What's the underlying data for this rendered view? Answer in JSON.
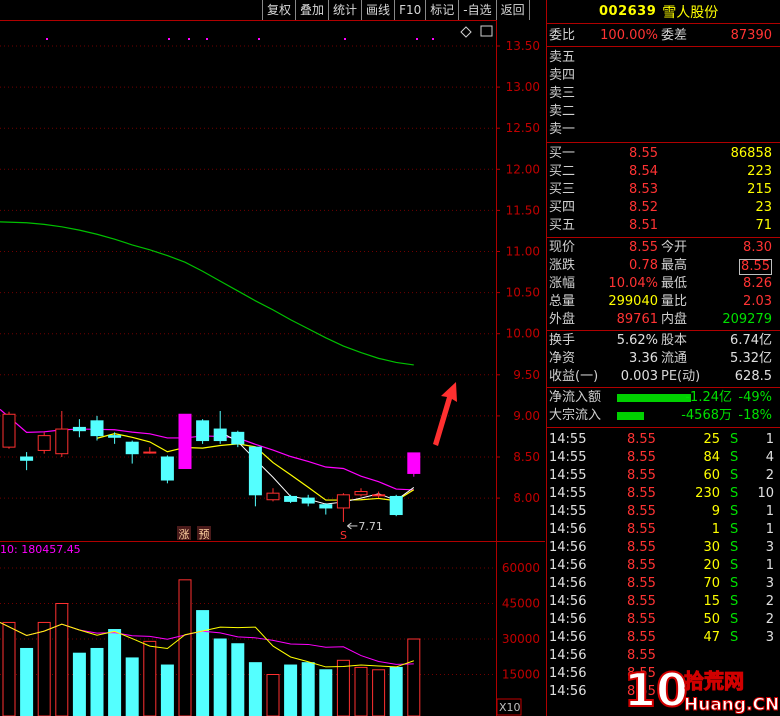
{
  "toolbar": {
    "items": [
      "复权",
      "叠加",
      "统计",
      "画线",
      "F10",
      "标记",
      "-自选",
      "返回"
    ]
  },
  "chart": {
    "price_axis": [
      "13.50",
      "13.00",
      "12.50",
      "12.00",
      "11.50",
      "11.00",
      "10.50",
      "10.00",
      "9.50",
      "9.00",
      "8.50",
      "8.00"
    ],
    "volume_axis": [
      "60000",
      "45000",
      "30000",
      "15000"
    ],
    "volume_unit": "X10",
    "volume_readout": "10: 180457.45",
    "low_marker": "7.71",
    "badge_zhang": "涨",
    "badge_yu": "预",
    "badge_s": "S",
    "colors": {
      "up": "#ff3030",
      "down": "#54ffff",
      "limit_up": "#ff00ff",
      "ma_fast": "#ffffff",
      "ma_mid": "#ffff00",
      "ma_slow": "#ff00ff",
      "ma_long": "#00c000",
      "arrow": "#ff3030"
    }
  },
  "panel": {
    "code": "002639",
    "name": "雪人股份",
    "weibi_label": "委比",
    "weibi_value": "100.00%",
    "weicha_label": "委差",
    "weicha_value": "87390",
    "asks": [
      {
        "label": "卖五",
        "price": "",
        "vol": ""
      },
      {
        "label": "卖四",
        "price": "",
        "vol": ""
      },
      {
        "label": "卖三",
        "price": "",
        "vol": ""
      },
      {
        "label": "卖二",
        "price": "",
        "vol": ""
      },
      {
        "label": "卖一",
        "price": "",
        "vol": ""
      }
    ],
    "bids": [
      {
        "label": "买一",
        "price": "8.55",
        "vol": "86858"
      },
      {
        "label": "买二",
        "price": "8.54",
        "vol": "223"
      },
      {
        "label": "买三",
        "price": "8.53",
        "vol": "215"
      },
      {
        "label": "买四",
        "price": "8.52",
        "vol": "23"
      },
      {
        "label": "买五",
        "price": "8.51",
        "vol": "71"
      }
    ],
    "quote": [
      {
        "l1": "现价",
        "v1": "8.55",
        "c1": "red",
        "l2": "今开",
        "v2": "8.30",
        "c2": "red"
      },
      {
        "l1": "涨跌",
        "v1": "0.78",
        "c1": "red",
        "l2": "最高",
        "v2": "8.55",
        "c2": "red"
      },
      {
        "l1": "涨幅",
        "v1": "10.04%",
        "c1": "red",
        "l2": "最低",
        "v2": "8.26",
        "c2": "red"
      },
      {
        "l1": "总量",
        "v1": "299040",
        "c1": "yellow",
        "l2": "量比",
        "v2": "2.03",
        "c2": "red"
      },
      {
        "l1": "外盘",
        "v1": "89761",
        "c1": "red",
        "l2": "内盘",
        "v2": "209279",
        "c2": "green"
      }
    ],
    "fundamentals": [
      {
        "l1": "换手",
        "v1": "5.62%",
        "l2": "股本",
        "v2": "6.74亿"
      },
      {
        "l1": "净资",
        "v1": "3.36",
        "l2": "流通",
        "v2": "5.32亿"
      },
      {
        "l1": "收益(一)",
        "v1": "0.003",
        "l2": "PE(动)",
        "v2": "628.5"
      }
    ],
    "flows": [
      {
        "label": "净流入额",
        "amount": "-1.24亿",
        "pct": "-49%",
        "bar": 0.49
      },
      {
        "label": "大宗流入",
        "amount": "-4568万",
        "pct": "-18%",
        "bar": 0.18
      }
    ],
    "ticks": [
      {
        "time": "14:55",
        "price": "8.55",
        "vol": "25",
        "bs": "S",
        "cnt": "1"
      },
      {
        "time": "14:55",
        "price": "8.55",
        "vol": "84",
        "bs": "S",
        "cnt": "4"
      },
      {
        "time": "14:55",
        "price": "8.55",
        "vol": "60",
        "bs": "S",
        "cnt": "2"
      },
      {
        "time": "14:55",
        "price": "8.55",
        "vol": "230",
        "bs": "S",
        "cnt": "10"
      },
      {
        "time": "14:55",
        "price": "8.55",
        "vol": "9",
        "bs": "S",
        "cnt": "1"
      },
      {
        "time": "14:56",
        "price": "8.55",
        "vol": "1",
        "bs": "S",
        "cnt": "1"
      },
      {
        "time": "14:56",
        "price": "8.55",
        "vol": "30",
        "bs": "S",
        "cnt": "3"
      },
      {
        "time": "14:56",
        "price": "8.55",
        "vol": "20",
        "bs": "S",
        "cnt": "1"
      },
      {
        "time": "14:56",
        "price": "8.55",
        "vol": "70",
        "bs": "S",
        "cnt": "3"
      },
      {
        "time": "14:56",
        "price": "8.55",
        "vol": "15",
        "bs": "S",
        "cnt": "2"
      },
      {
        "time": "14:56",
        "price": "8.55",
        "vol": "50",
        "bs": "S",
        "cnt": "2"
      },
      {
        "time": "14:56",
        "price": "8.55",
        "vol": "47",
        "bs": "S",
        "cnt": "3"
      },
      {
        "time": "14:56",
        "price": "8.55",
        "vol": "",
        "bs": "",
        "cnt": ""
      },
      {
        "time": "14:56",
        "price": "8.55",
        "vol": "",
        "bs": "",
        "cnt": ""
      },
      {
        "time": "14:56",
        "price": "8.55",
        "vol": "",
        "bs": "",
        "cnt": ""
      }
    ]
  },
  "watermark": {
    "brand": "10 拾荒网",
    "domain": "Huang.CN"
  },
  "chart_data": {
    "type": "candlestick",
    "candles": [
      {
        "open": 8.62,
        "close": 9.02,
        "high": 9.05,
        "low": 8.6
      },
      {
        "open": 8.5,
        "close": 8.46,
        "high": 8.56,
        "low": 8.34
      },
      {
        "open": 8.58,
        "close": 8.76,
        "high": 8.8,
        "low": 8.54
      },
      {
        "open": 8.54,
        "close": 8.84,
        "high": 9.06,
        "low": 8.5
      },
      {
        "open": 8.86,
        "close": 8.82,
        "high": 8.96,
        "low": 8.74
      },
      {
        "open": 8.94,
        "close": 8.76,
        "high": 9.0,
        "low": 8.7
      },
      {
        "open": 8.76,
        "close": 8.74,
        "high": 8.8,
        "low": 8.66
      },
      {
        "open": 8.68,
        "close": 8.54,
        "high": 8.7,
        "low": 8.42
      },
      {
        "open": 8.56,
        "close": 8.56,
        "high": 8.62,
        "low": 8.54
      },
      {
        "open": 8.5,
        "close": 8.22,
        "high": 8.52,
        "low": 8.18
      },
      {
        "open": 8.36,
        "close": 9.02,
        "high": 9.02,
        "low": 8.36
      },
      {
        "open": 8.94,
        "close": 8.7,
        "high": 8.96,
        "low": 8.66
      },
      {
        "open": 8.84,
        "close": 8.7,
        "high": 9.06,
        "low": 8.66
      },
      {
        "open": 8.8,
        "close": 8.66,
        "high": 8.82,
        "low": 8.62
      },
      {
        "open": 8.62,
        "close": 8.04,
        "high": 8.62,
        "low": 7.9
      },
      {
        "open": 7.98,
        "close": 8.06,
        "high": 8.12,
        "low": 7.96
      },
      {
        "open": 8.02,
        "close": 7.96,
        "high": 8.04,
        "low": 7.94
      },
      {
        "open": 8.0,
        "close": 7.94,
        "high": 8.04,
        "low": 7.9
      },
      {
        "open": 7.92,
        "close": 7.88,
        "high": 7.94,
        "low": 7.8
      },
      {
        "open": 7.88,
        "close": 8.04,
        "high": 8.06,
        "low": 7.71
      },
      {
        "open": 8.04,
        "close": 8.08,
        "high": 8.12,
        "low": 8.02
      },
      {
        "open": 8.04,
        "close": 8.04,
        "high": 8.08,
        "low": 8.0
      },
      {
        "open": 8.02,
        "close": 7.8,
        "high": 8.04,
        "low": 7.78
      },
      {
        "open": 8.3,
        "close": 8.55,
        "high": 8.55,
        "low": 8.26
      }
    ],
    "volumes": [
      37000,
      26000,
      37000,
      45000,
      24000,
      26000,
      34000,
      22000,
      29000,
      19000,
      55000,
      42000,
      30000,
      28000,
      20000,
      15000,
      19000,
      20000,
      17000,
      21000,
      18000,
      17000,
      18000,
      30000
    ],
    "ma_long": [
      11.36,
      11.35,
      11.33,
      11.3,
      11.26,
      11.21,
      11.15,
      11.08,
      11.02,
      10.95,
      10.87,
      10.76,
      10.64,
      10.52,
      10.4,
      10.29,
      10.17,
      10.06,
      9.95,
      9.85,
      9.77,
      9.7,
      9.65,
      9.62
    ],
    "ylim": [
      7.7,
      13.6
    ],
    "volume_ylim": [
      0,
      66000
    ]
  }
}
